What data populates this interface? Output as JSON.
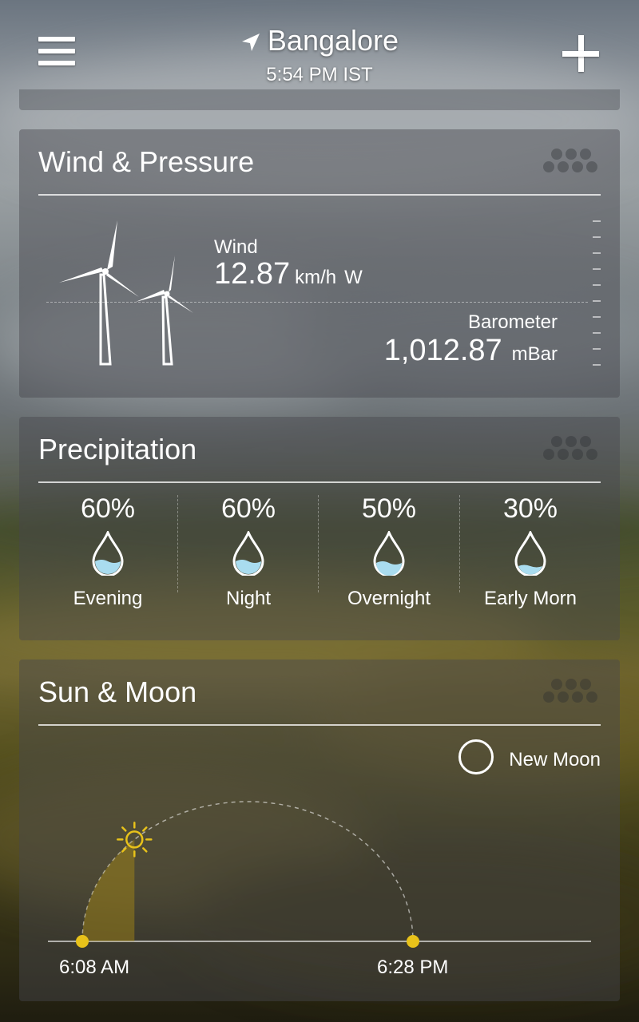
{
  "header": {
    "city": "Bangalore",
    "time": "5:54 PM IST"
  },
  "wind_pressure": {
    "title": "Wind & Pressure",
    "wind_label": "Wind",
    "wind_speed": "12.87",
    "wind_unit": "km/h",
    "wind_dir": "W",
    "barometer_label": "Barometer",
    "barometer_value": "1,012.87",
    "barometer_unit": "mBar"
  },
  "precipitation": {
    "title": "Precipitation",
    "periods": [
      {
        "percent": "60%",
        "label": "Evening",
        "chance": 0.6
      },
      {
        "percent": "60%",
        "label": "Night",
        "chance": 0.6
      },
      {
        "percent": "50%",
        "label": "Overnight",
        "chance": 0.5
      },
      {
        "percent": "30%",
        "label": "Early Morn",
        "chance": 0.3
      }
    ]
  },
  "sun_moon": {
    "title": "Sun & Moon",
    "moon_phase": "New Moon",
    "sunrise": "6:08 AM",
    "sunset": "6:28 PM",
    "sun_progress": 0.26
  },
  "colors": {
    "sun_yellow": "#e8c21a",
    "drop_water": "#a9dcef"
  }
}
